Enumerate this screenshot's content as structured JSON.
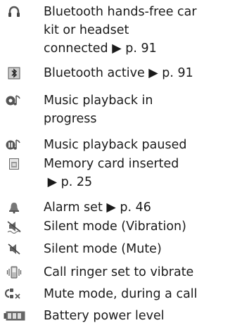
{
  "entries": [
    {
      "icon": "bluetooth-headset-icon",
      "lines": [
        "Bluetooth hands-free car",
        "kit or headset",
        "connected ▶ p. 91"
      ]
    },
    {
      "icon": "bluetooth-active-icon",
      "lines": [
        "Bluetooth active ▶ p. 91"
      ]
    },
    {
      "icon": "music-playing-icon",
      "lines": [
        "Music playback in",
        "progress"
      ]
    },
    {
      "icon": "music-paused-icon",
      "lines": [
        "Music playback paused"
      ]
    },
    {
      "icon": "memory-card-icon",
      "lines": [
        "Memory card inserted",
        " ▶ p. 25"
      ]
    },
    {
      "icon": "alarm-bell-icon",
      "lines": [
        "Alarm set ▶ p. 46"
      ]
    },
    {
      "icon": "silent-vibration-icon",
      "lines": [
        "Silent mode (Vibration)"
      ]
    },
    {
      "icon": "silent-mute-icon",
      "lines": [
        "Silent mode (Mute)"
      ]
    },
    {
      "icon": "vibrate-ringer-icon",
      "lines": [
        "Call ringer set to vibrate"
      ]
    },
    {
      "icon": "mute-call-icon",
      "lines": [
        "Mute mode, during a call"
      ]
    },
    {
      "icon": "battery-level-icon",
      "lines": [
        "Battery power level"
      ]
    }
  ]
}
